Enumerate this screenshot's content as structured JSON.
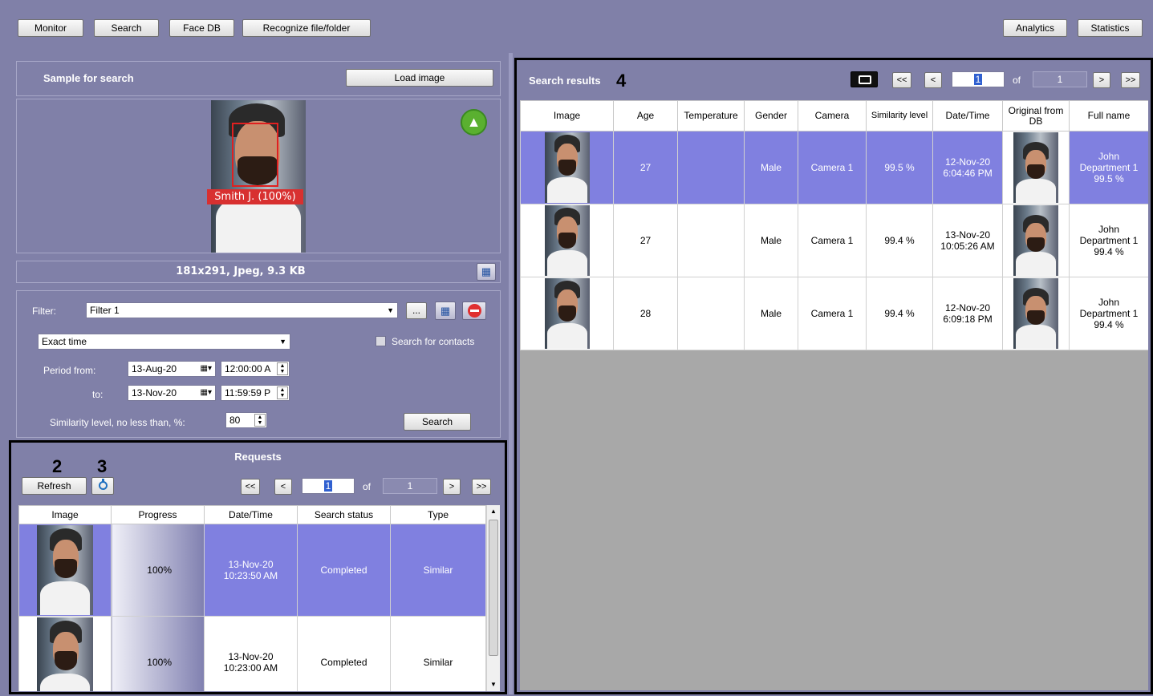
{
  "toolbar": {
    "monitor": "Monitor",
    "search": "Search",
    "face_db": "Face DB",
    "recognize": "Recognize file/folder",
    "analytics": "Analytics",
    "statistics": "Statistics"
  },
  "sample": {
    "title": "Sample for search",
    "load_image": "Load image",
    "face_label": "Smith J. (100%)",
    "info": "181x291, Jpeg, 9.3 KB"
  },
  "filter": {
    "label": "Filter:",
    "value": "Filter 1",
    "more_btn": "...",
    "time_mode": "Exact time",
    "search_contacts": "Search for contacts",
    "period_from_label": "Period from:",
    "to_label": "to:",
    "from_date": "13-Aug-20",
    "from_time": "12:00:00 A",
    "to_date": "13-Nov-20",
    "to_time": "11:59:59 P",
    "similarity_label": "Similarity level, no less than, %:",
    "similarity_value": "80",
    "search_btn": "Search"
  },
  "requests": {
    "title": "Requests",
    "refresh": "Refresh",
    "page": "1",
    "of": "of",
    "total": "1",
    "nav": {
      "first": "<<",
      "prev": "<",
      "next": ">",
      "last": ">>"
    },
    "columns": [
      "Image",
      "Progress",
      "Date/Time",
      "Search status",
      "Type"
    ],
    "rows": [
      {
        "progress": "100%",
        "date": "13-Nov-20",
        "time": "10:23:50 AM",
        "status": "Completed",
        "type": "Similar"
      },
      {
        "progress": "100%",
        "date": "13-Nov-20",
        "time": "10:23:00 AM",
        "status": "Completed",
        "type": "Similar"
      }
    ]
  },
  "results": {
    "title": "Search results",
    "page": "1",
    "of": "of",
    "total": "1",
    "nav": {
      "first": "<<",
      "prev": "<",
      "next": ">",
      "last": ">>"
    },
    "columns": [
      "Image",
      "Age",
      "Temperature",
      "Gender",
      "Camera",
      "Similarity level",
      "Date/Time",
      "Original from DB",
      "Full name"
    ],
    "rows": [
      {
        "age": "27",
        "temperature": "",
        "gender": "Male",
        "camera": "Camera 1",
        "similarity": "99.5 %",
        "date": "12-Nov-20",
        "time": "6:04:46 PM",
        "name1": "John",
        "name2": "Department 1",
        "name3": "99.5 %"
      },
      {
        "age": "27",
        "temperature": "",
        "gender": "Male",
        "camera": "Camera 1",
        "similarity": "99.4 %",
        "date": "13-Nov-20",
        "time": "10:05:26 AM",
        "name1": "John",
        "name2": "Department 1",
        "name3": "99.4 %"
      },
      {
        "age": "28",
        "temperature": "",
        "gender": "Male",
        "camera": "Camera 1",
        "similarity": "99.4 %",
        "date": "12-Nov-20",
        "time": "6:09:18 PM",
        "name1": "John",
        "name2": "Department 1",
        "name3": "99.4 %"
      }
    ]
  },
  "callouts": {
    "c2": "2",
    "c3": "3",
    "c4": "4"
  },
  "colors": {
    "background": "#8080a8",
    "selected_row": "#8080e0",
    "like_badge": "#5ab030",
    "face_box": "#e02020"
  }
}
